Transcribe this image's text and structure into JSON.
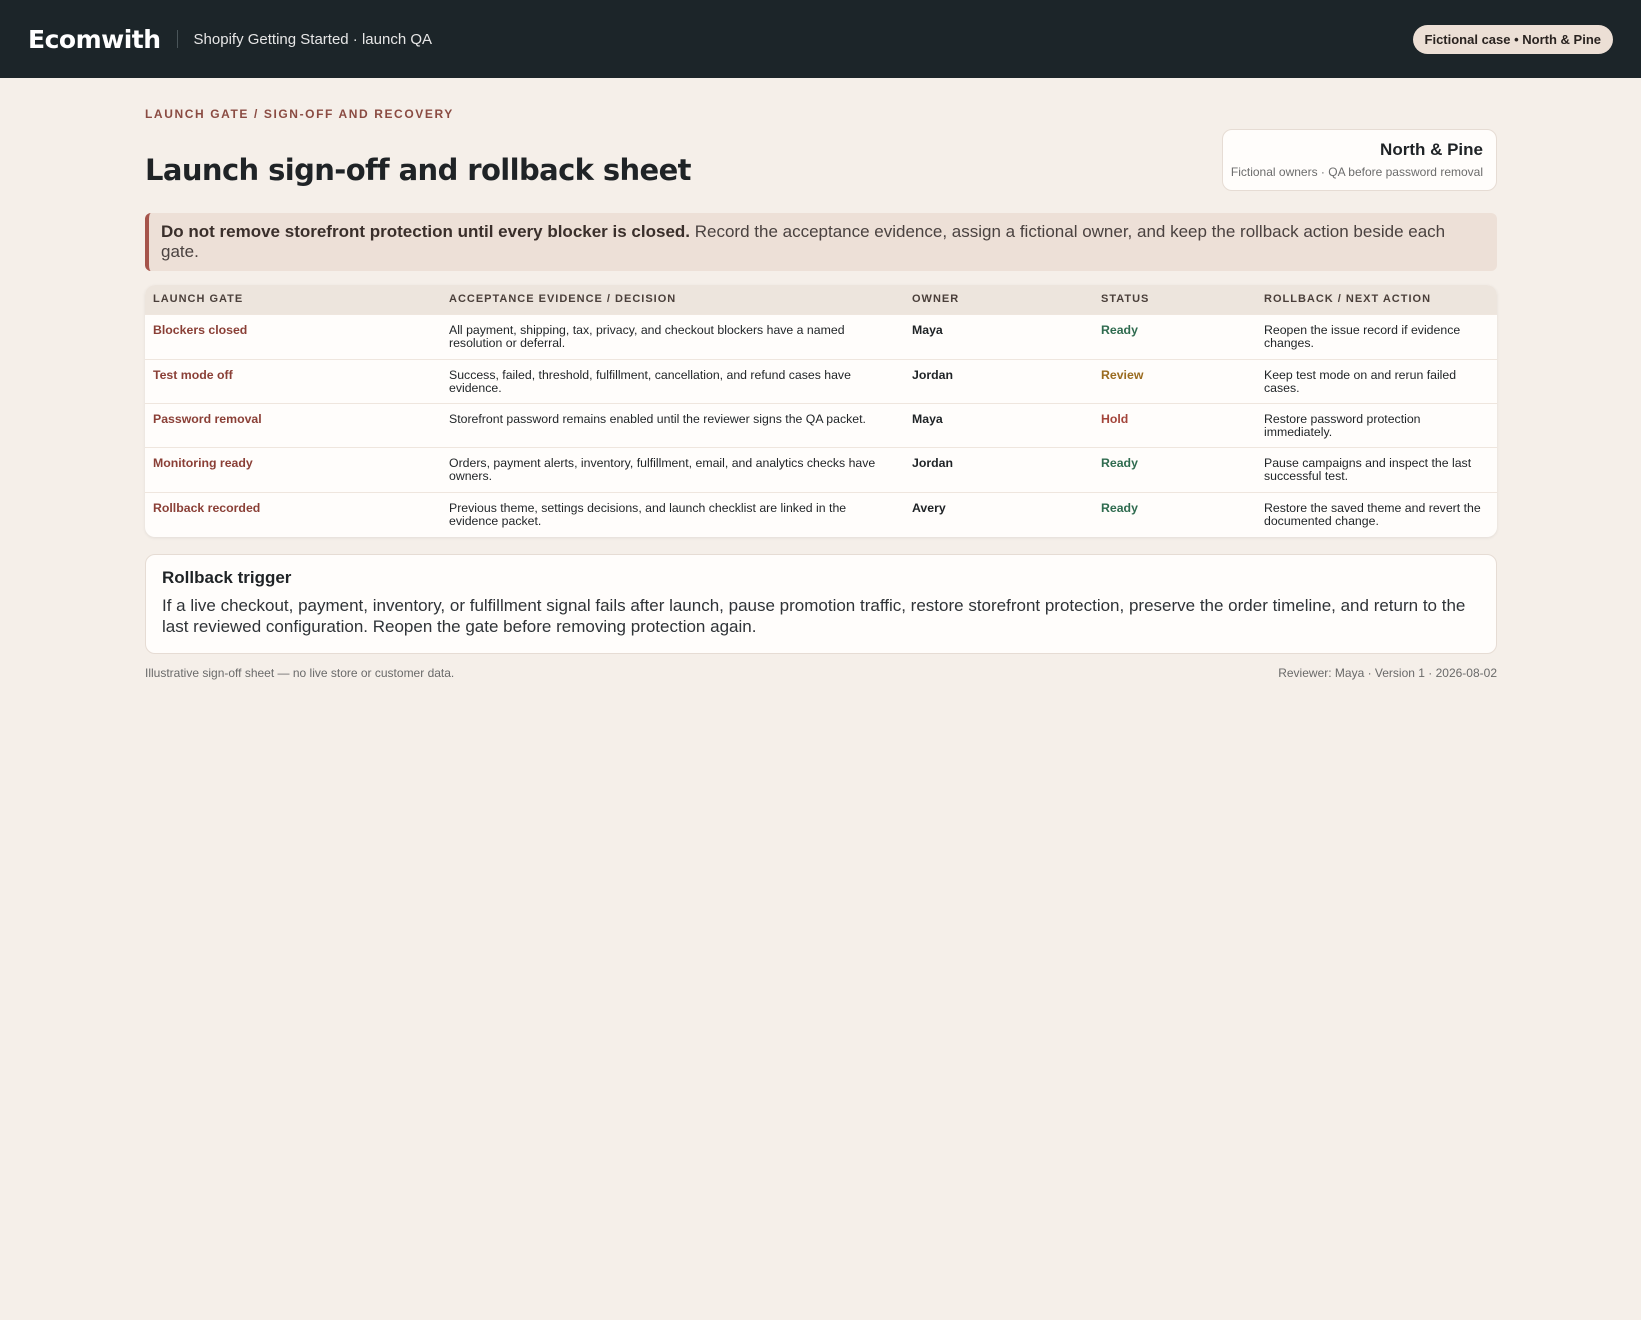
{
  "header": {
    "brand": "Ecomwith",
    "subtitle": "Shopify Getting Started · launch QA",
    "pill": "Fictional case • North & Pine"
  },
  "page": {
    "eyebrow": "LAUNCH GATE / SIGN-OFF AND RECOVERY",
    "title": "Launch sign-off and rollback sheet"
  },
  "store_card": {
    "name": "North & Pine",
    "sub": "Fictional owners · QA before password removal"
  },
  "alert": {
    "bold": "Do not remove storefront protection until every blocker is closed.",
    "text": " Record the acceptance evidence, assign a fictional owner, and keep the rollback action beside each gate."
  },
  "table": {
    "headers": [
      "LAUNCH GATE",
      "ACCEPTANCE EVIDENCE / DECISION",
      "OWNER",
      "STATUS",
      "ROLLBACK / NEXT ACTION"
    ],
    "rows": [
      {
        "gate": "Blockers closed",
        "evidence": "All payment, shipping, tax, privacy, and checkout blockers have a named resolution or deferral.",
        "owner": "Maya",
        "status": "Ready",
        "status_kind": "ready",
        "rollback": "Reopen the issue record if evidence changes."
      },
      {
        "gate": "Test mode off",
        "evidence": "Success, failed, threshold, fulfillment, cancellation, and refund cases have evidence.",
        "owner": "Jordan",
        "status": "Review",
        "status_kind": "review",
        "rollback": "Keep test mode on and rerun failed cases."
      },
      {
        "gate": "Password removal",
        "evidence": "Storefront password remains enabled until the reviewer signs the QA packet.",
        "owner": "Maya",
        "status": "Hold",
        "status_kind": "hold",
        "rollback": "Restore password protection immediately."
      },
      {
        "gate": "Monitoring ready",
        "evidence": "Orders, payment alerts, inventory, fulfillment, email, and analytics checks have owners.",
        "owner": "Jordan",
        "status": "Ready",
        "status_kind": "ready",
        "rollback": "Pause campaigns and inspect the last successful test."
      },
      {
        "gate": "Rollback recorded",
        "evidence": "Previous theme, settings decisions, and launch checklist are linked in the evidence packet.",
        "owner": "Avery",
        "status": "Ready",
        "status_kind": "ready",
        "rollback": "Restore the saved theme and revert the documented change."
      }
    ]
  },
  "trigger": {
    "title": "Rollback trigger",
    "text": "If a live checkout, payment, inventory, or fulfillment signal fails after launch, pause promotion traffic, restore storefront protection, preserve the order timeline, and return to the last reviewed configuration. Reopen the gate before removing protection again."
  },
  "footer": {
    "left": "Illustrative sign-off sheet — no live store or customer data.",
    "right": "Reviewer: Maya · Version 1 · 2026-08-02"
  },
  "colors": {
    "topbar": "#1c2529",
    "background": "#f5efe9",
    "accent": "#8a3f36",
    "ready": "#2f6b4f",
    "review": "#9a6b1f",
    "hold": "#a3443a"
  }
}
